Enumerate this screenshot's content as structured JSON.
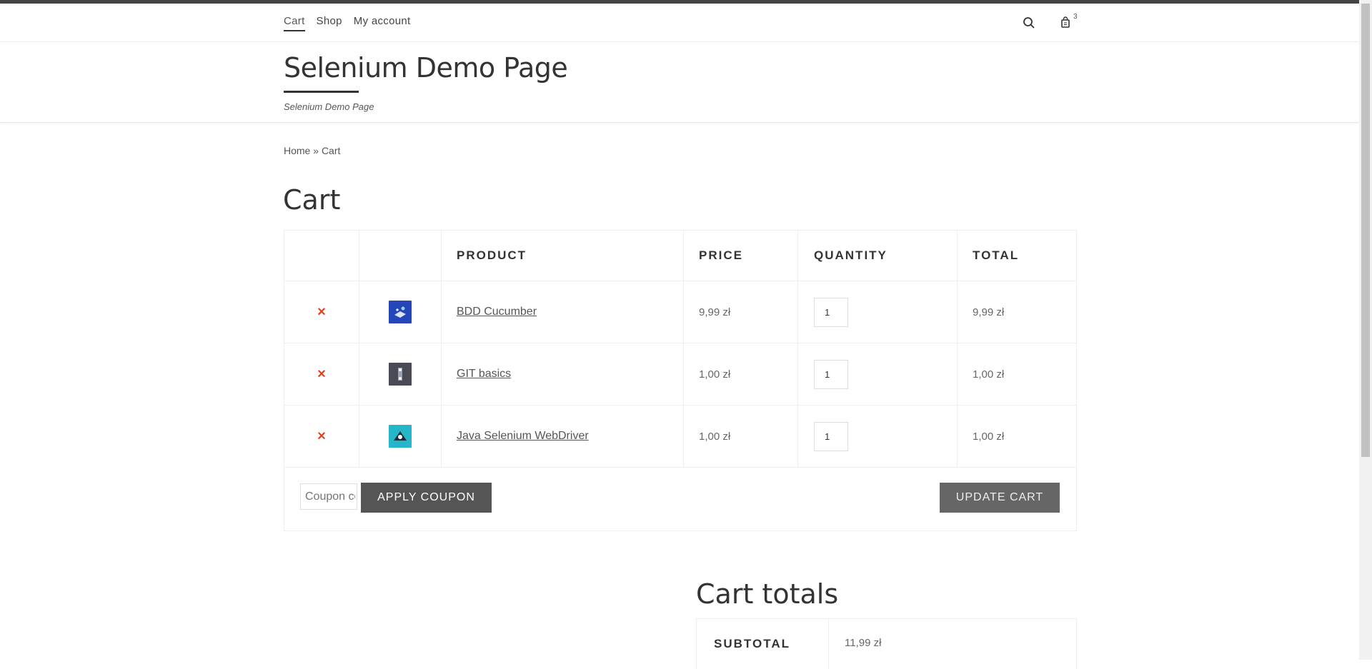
{
  "nav": {
    "links": [
      {
        "label": "Cart",
        "active": true
      },
      {
        "label": "Shop",
        "active": false
      },
      {
        "label": "My account",
        "active": false
      }
    ],
    "cart_count": "3",
    "search_icon": "search-icon",
    "cart_icon": "shopping-bag-icon"
  },
  "header": {
    "title": "Selenium Demo Page",
    "tagline": "Selenium Demo Page"
  },
  "breadcrumb": {
    "home": "Home",
    "separator": "»",
    "current": "Cart"
  },
  "page_title": "Cart",
  "cart_table": {
    "headers": {
      "product": "PRODUCT",
      "price": "PRICE",
      "quantity": "QUANTITY",
      "total": "TOTAL"
    },
    "remove_symbol": "×",
    "items": [
      {
        "name": "BDD Cucumber",
        "price": "9,99 zł",
        "quantity": "1",
        "total": "9,99 zł",
        "thumb_color": "#2347b8"
      },
      {
        "name": "GIT basics",
        "price": "1,00 zł",
        "quantity": "1",
        "total": "1,00 zł",
        "thumb_color": "#4a4a55"
      },
      {
        "name": "Java Selenium WebDriver",
        "price": "1,00 zł",
        "quantity": "1",
        "total": "1,00 zł",
        "thumb_color": "#26b6c9"
      }
    ],
    "coupon_placeholder": "Coupon code",
    "apply_coupon_label": "APPLY COUPON",
    "update_cart_label": "UPDATE CART"
  },
  "cart_totals": {
    "title": "Cart totals",
    "subtotal_label": "SUBTOTAL",
    "subtotal_value": "11,99 zł"
  },
  "colors": {
    "remove": "#e2401c",
    "button": "#555555"
  }
}
